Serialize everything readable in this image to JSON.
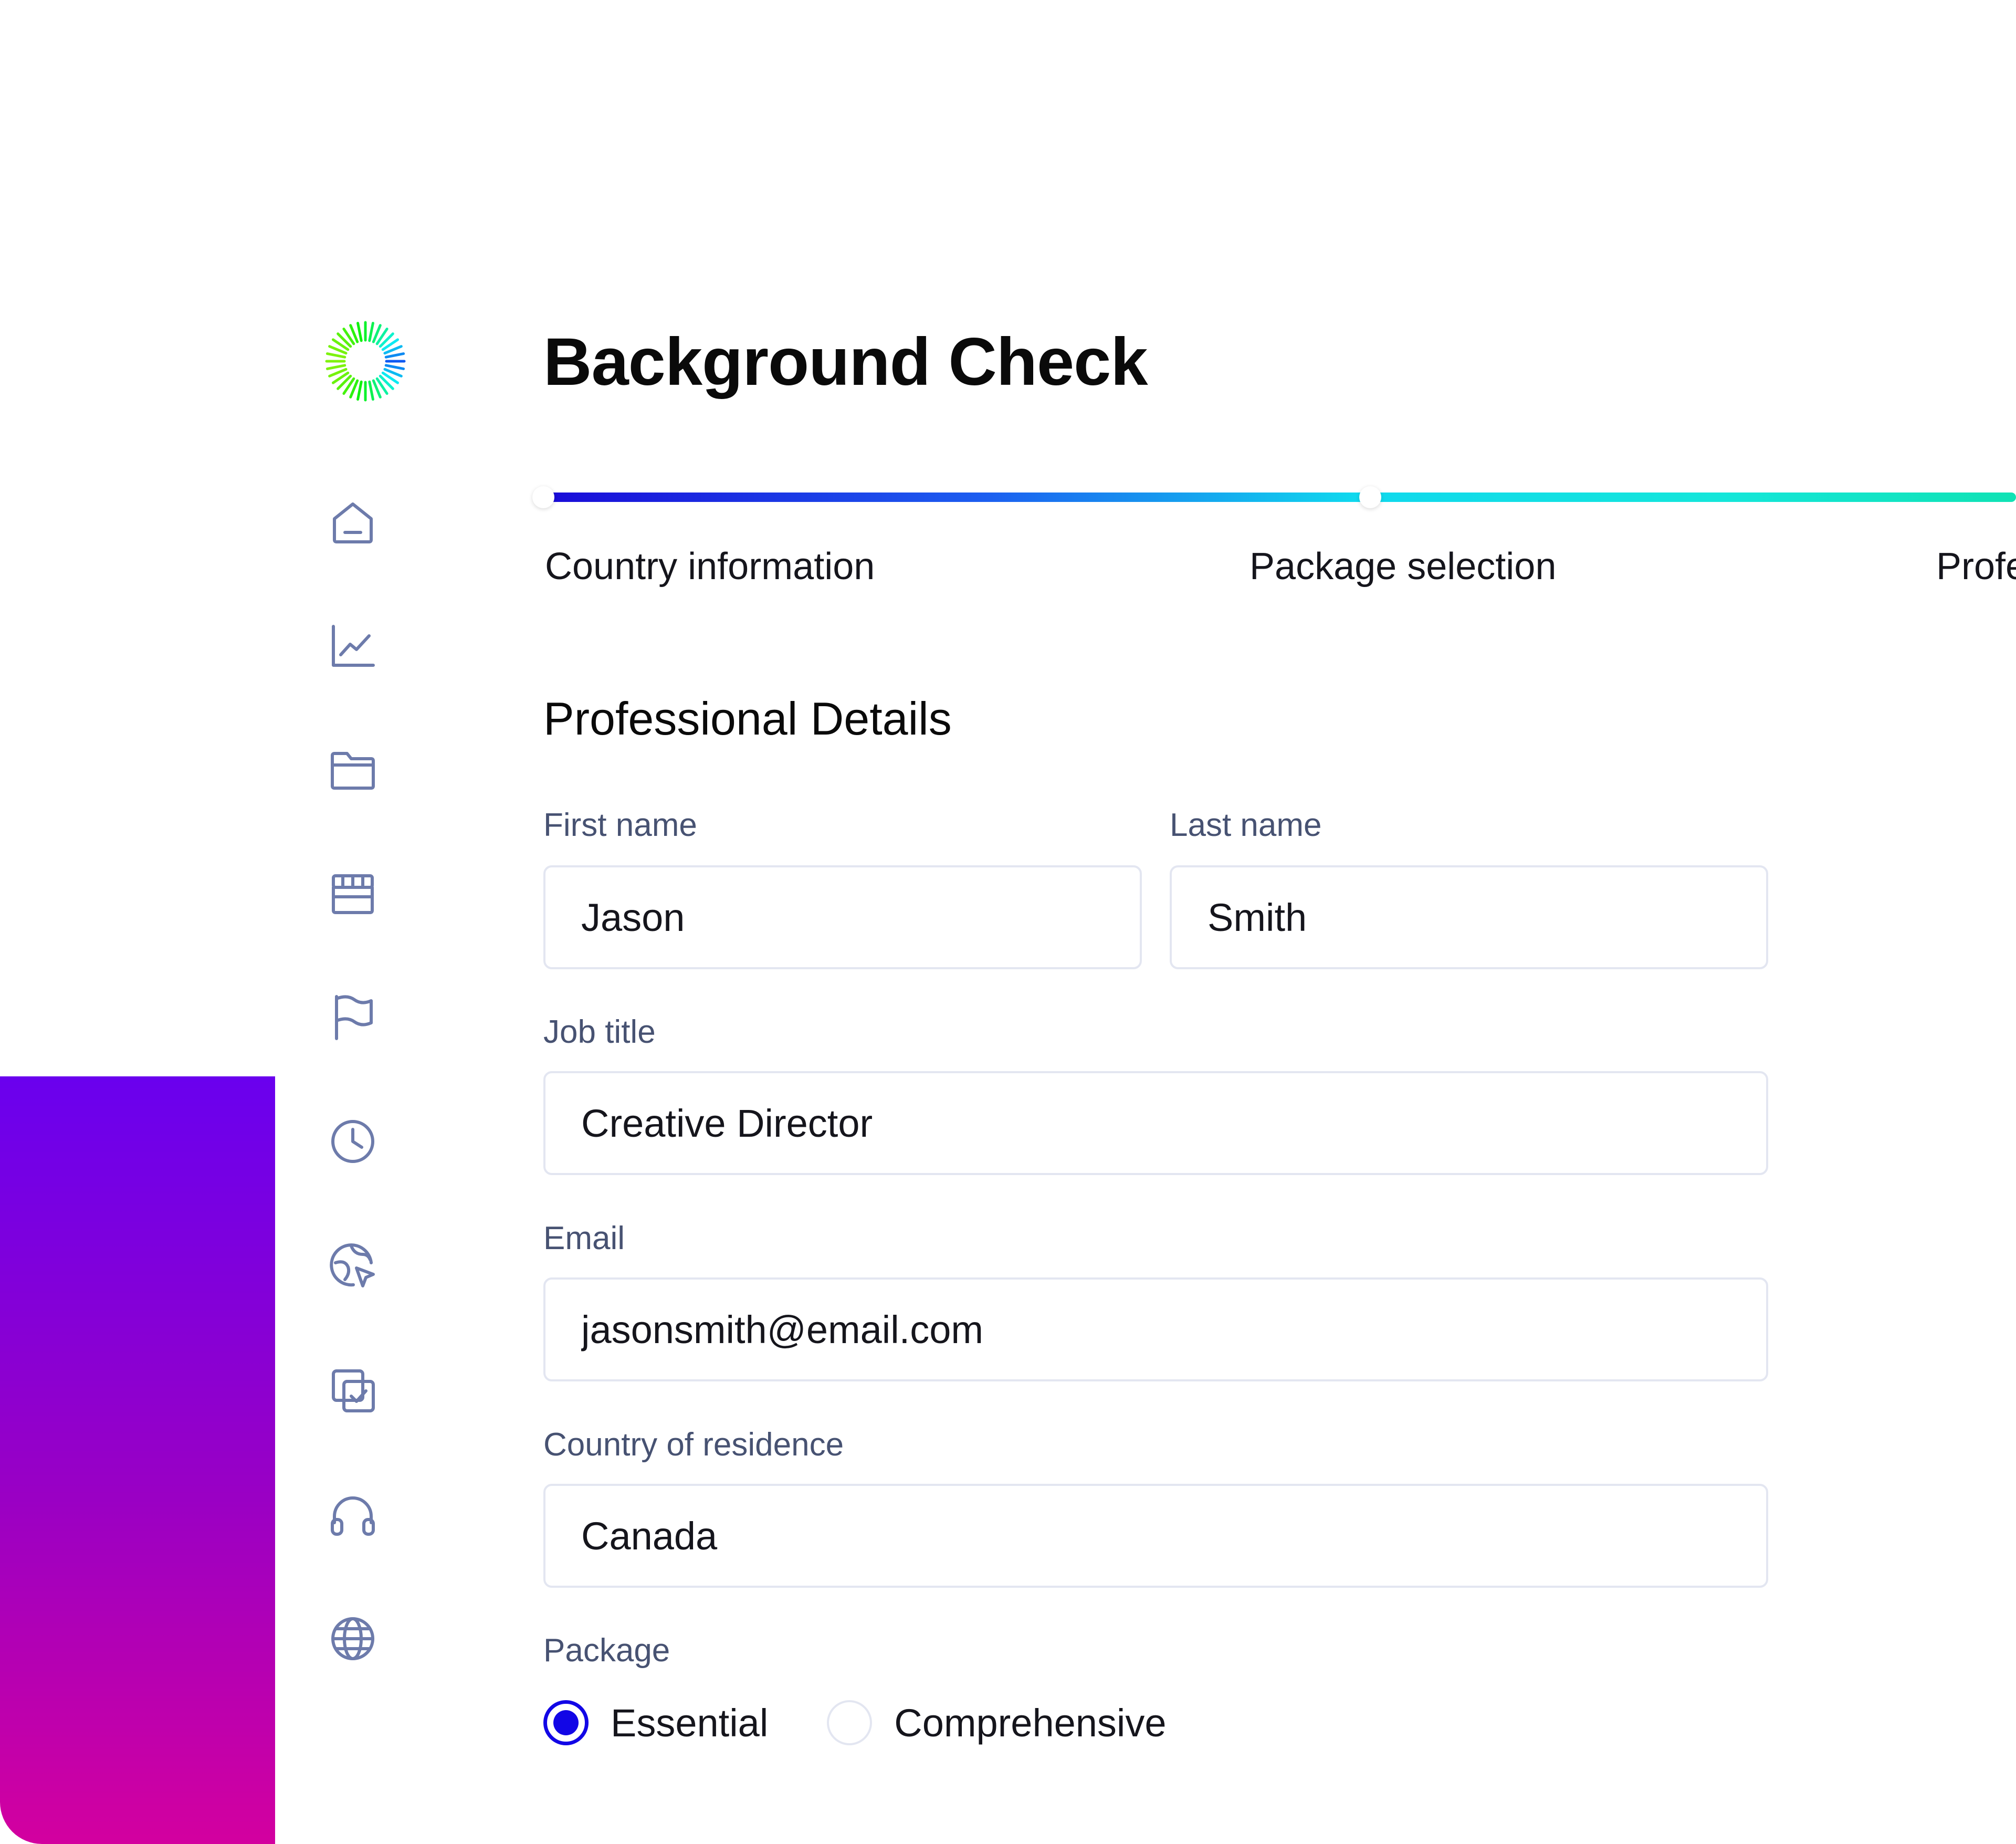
{
  "page": {
    "title": "Background Check"
  },
  "sidebar": {
    "items": [
      {
        "icon": "home-icon"
      },
      {
        "icon": "chart-icon"
      },
      {
        "icon": "folder-icon"
      },
      {
        "icon": "store-icon"
      },
      {
        "icon": "flag-icon"
      },
      {
        "icon": "clock-icon"
      },
      {
        "icon": "globe-cursor-icon"
      },
      {
        "icon": "copy-check-icon"
      },
      {
        "icon": "headphones-icon"
      },
      {
        "icon": "globe-icon"
      }
    ]
  },
  "progress": {
    "steps": [
      {
        "label": "Country information"
      },
      {
        "label": "Package selection"
      },
      {
        "label": "Profe"
      }
    ],
    "colors": [
      "#1a0bd8",
      "#10d8ee",
      "#10e2b4"
    ]
  },
  "form": {
    "section_title": "Professional Details",
    "first_name": {
      "label": "First name",
      "value": "Jason"
    },
    "last_name": {
      "label": "Last name",
      "value": "Smith"
    },
    "job_title": {
      "label": "Job title",
      "value": "Creative Director"
    },
    "email": {
      "label": "Email",
      "value": "jasonsmith@email.com"
    },
    "country": {
      "label": "Country of residence",
      "value": "Canada"
    },
    "package": {
      "label": "Package",
      "options": [
        "Essential",
        "Comprehensive"
      ],
      "selected": "Essential"
    }
  },
  "colors": {
    "accent": "#1206e6",
    "icon": "#6d7bab",
    "label": "#475272",
    "border": "#e3e6f1",
    "decor_gradient": [
      "#6a00ee",
      "#d3009f"
    ]
  }
}
